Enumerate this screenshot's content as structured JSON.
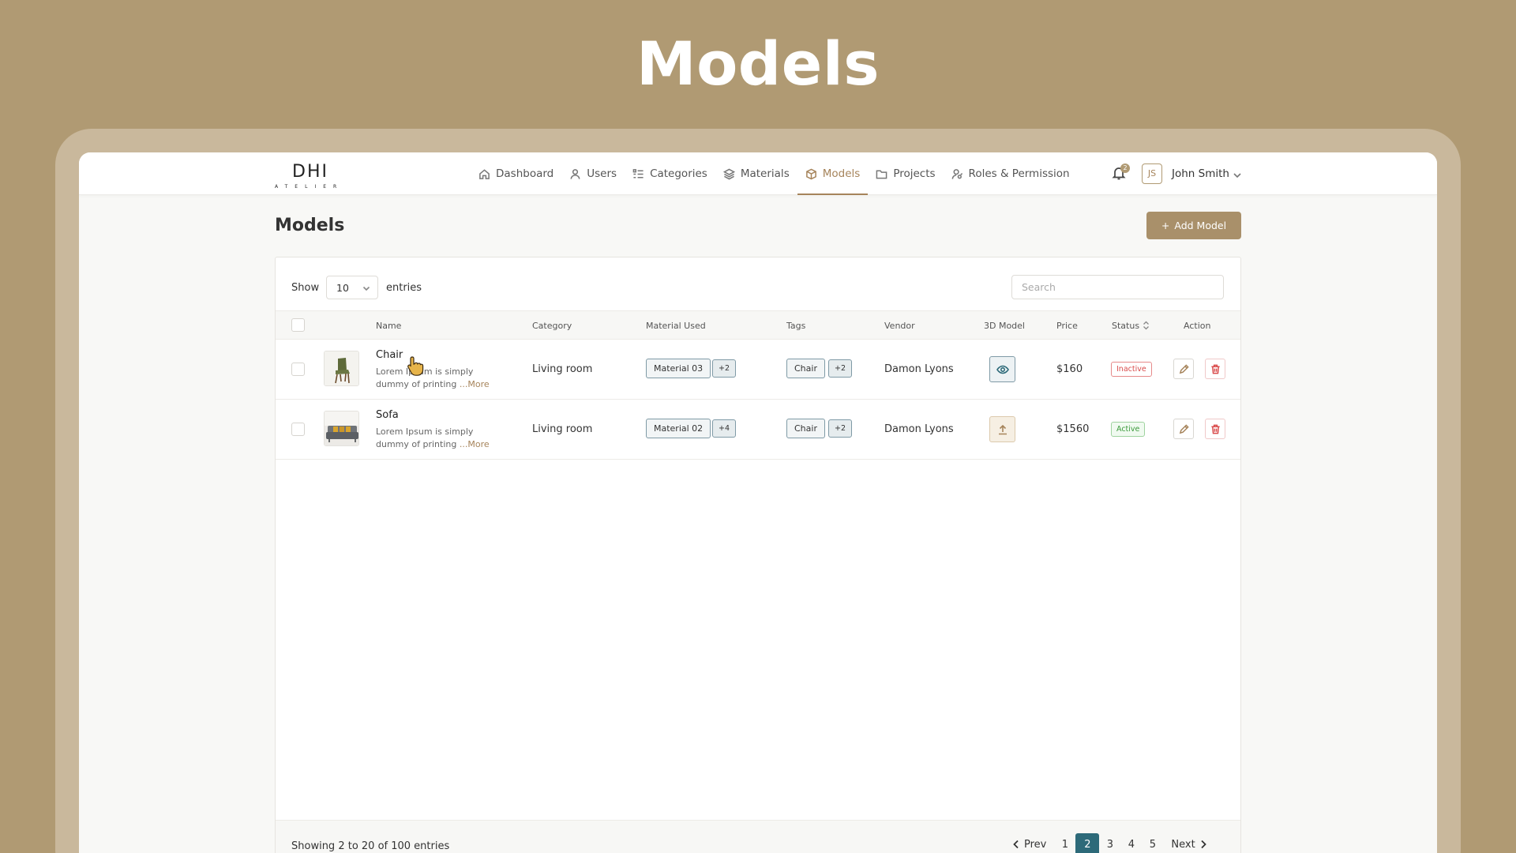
{
  "hero": {
    "title": "Models"
  },
  "logo": {
    "main": "DHI",
    "sub": "ATELIER"
  },
  "nav": {
    "items": [
      {
        "label": "Dashboard",
        "icon": "home-icon"
      },
      {
        "label": "Users",
        "icon": "user-icon"
      },
      {
        "label": "Categories",
        "icon": "list-icon"
      },
      {
        "label": "Materials",
        "icon": "layers-icon"
      },
      {
        "label": "Models",
        "icon": "box-icon",
        "active": true
      },
      {
        "label": "Projects",
        "icon": "folder-icon"
      },
      {
        "label": "Roles & Permission",
        "icon": "user-key-icon"
      }
    ],
    "notification_count": "2",
    "user_initials": "JS",
    "user_name": "John Smith"
  },
  "page": {
    "title": "Models",
    "add_label": "Add Model"
  },
  "toolbar": {
    "show_label": "Show",
    "page_size": "10",
    "entries_label": "entries",
    "search_placeholder": "Search"
  },
  "table": {
    "columns": [
      "Name",
      "Category",
      "Material Used",
      "Tags",
      "Vendor",
      "3D Model",
      "Price",
      "Status",
      "Action"
    ],
    "rows": [
      {
        "name": "Chair",
        "description": "Lorem Ipsum is simply dummy of printing",
        "more": "...More",
        "category": "Living room",
        "material": "Material 03",
        "material_more": "+2",
        "tag": "Chair",
        "tag_more": "+2",
        "vendor": "Damon Lyons",
        "model_action": "view",
        "price": "$160",
        "status": "Inactive"
      },
      {
        "name": "Sofa",
        "description": "Lorem Ipsum is simply dummy of printing",
        "more": "...More",
        "category": "Living room",
        "material": "Material 02",
        "material_more": "+4",
        "tag": "Chair",
        "tag_more": "+2",
        "vendor": "Damon Lyons",
        "model_action": "upload",
        "price": "$1560",
        "status": "Active"
      }
    ]
  },
  "footer": {
    "showing": "Showing 2 to 20 of 100 entries",
    "prev_label": "Prev",
    "next_label": "Next",
    "pages": [
      "1",
      "2",
      "3",
      "4",
      "5"
    ],
    "current_page": "2"
  },
  "colors": {
    "background": "#b09a73",
    "accent": "#a6845b",
    "primary": "#2d6a79",
    "danger": "#d94b4b",
    "success": "#3b9a3b"
  }
}
